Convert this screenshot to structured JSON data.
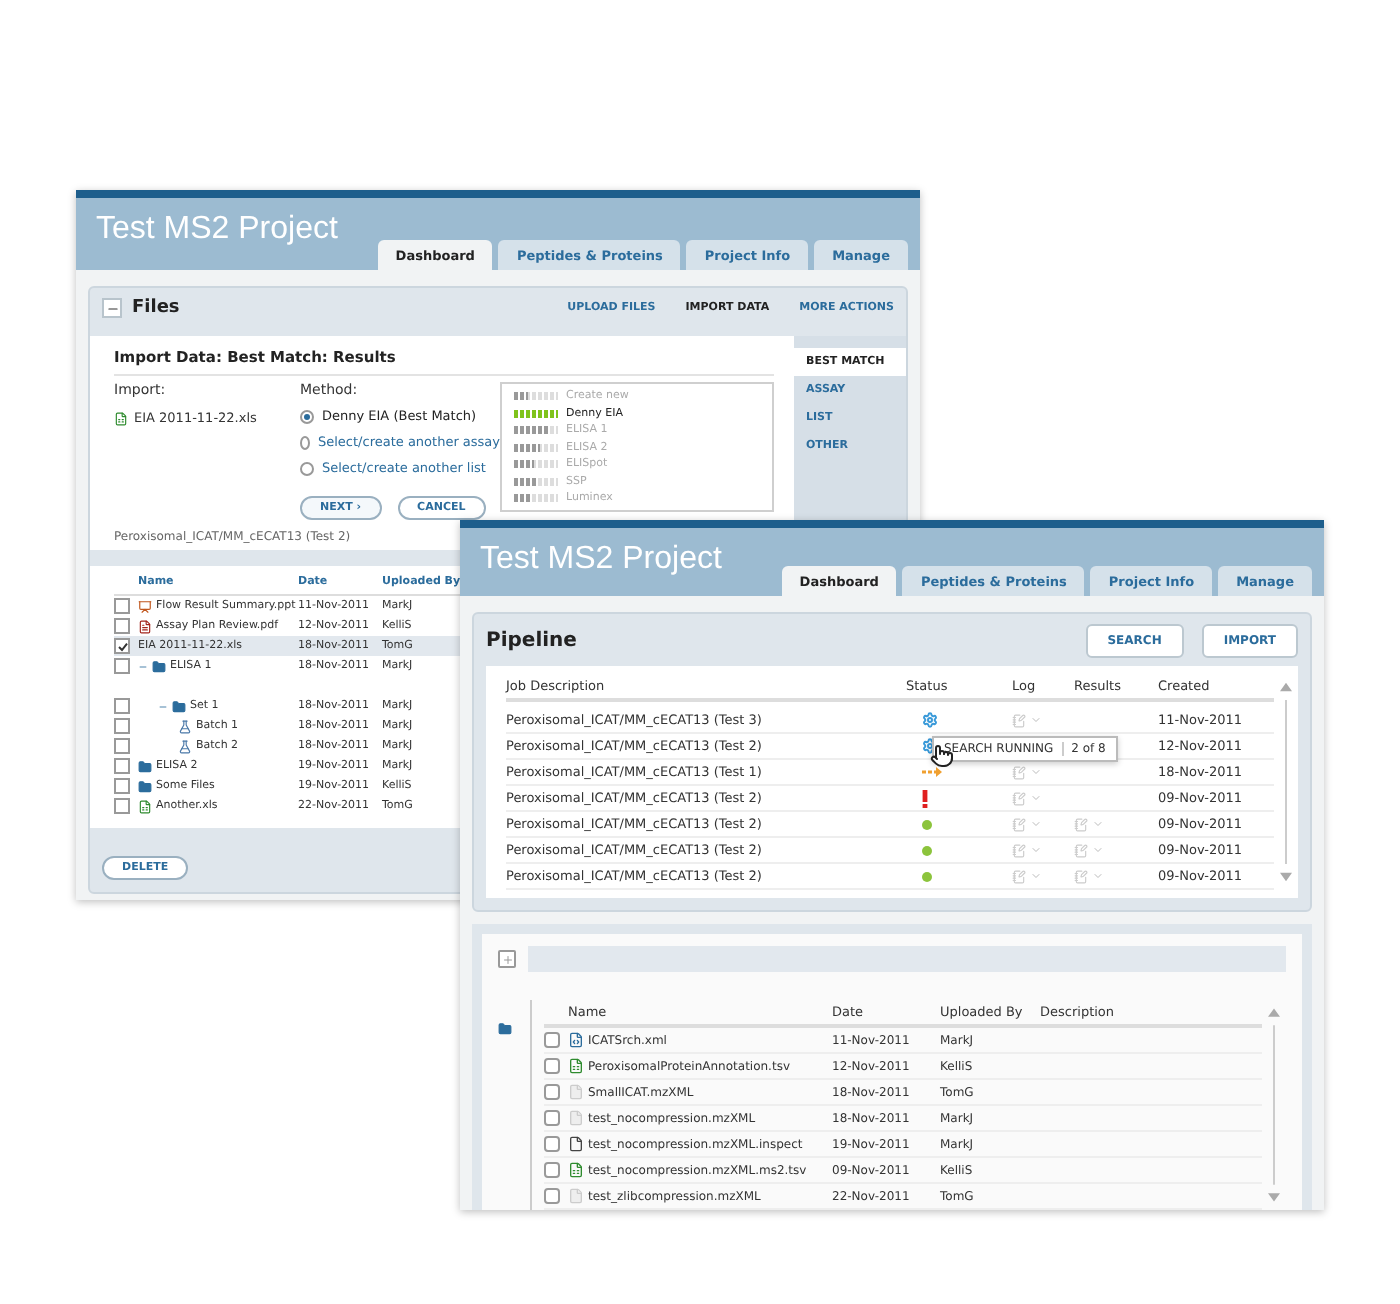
{
  "back_window": {
    "title": "Test MS2 Project",
    "tabs": [
      {
        "label": "Dashboard",
        "selected": true
      },
      {
        "label": "Peptides & Proteins",
        "selected": false
      },
      {
        "label": "Project Info",
        "selected": false
      },
      {
        "label": "Manage",
        "selected": false
      }
    ],
    "files_panel": {
      "title": "Files",
      "expanded": true,
      "actions": [
        {
          "label": "UPLOAD FILES",
          "selected": false
        },
        {
          "label": "IMPORT DATA",
          "selected": true
        },
        {
          "label": "MORE ACTIONS",
          "selected": false
        }
      ],
      "import_dialog": {
        "title": "Import Data: Best Match: Results",
        "import_label": "Import:",
        "file": "EIA 2011-11-22.xls",
        "method_label": "Method:",
        "methods": [
          {
            "label": "Denny EIA (Best Match)",
            "selected": true
          },
          {
            "label": "Select/create another assay",
            "selected": false
          },
          {
            "label": "Select/create another list",
            "selected": false
          }
        ],
        "buttons": [
          {
            "label": "NEXT ›",
            "kind": "primary"
          },
          {
            "label": "CANCEL",
            "kind": "secondary"
          }
        ],
        "matches": [
          {
            "label": "Create new",
            "level": 0.3,
            "selected": false
          },
          {
            "label": "Denny EIA",
            "level": 1,
            "selected": true
          },
          {
            "label": "ELISA 1",
            "level": 0.75,
            "selected": false
          },
          {
            "label": "ELISA 2",
            "level": 0.6,
            "selected": false
          },
          {
            "label": "ELISpot",
            "level": 0.45,
            "selected": false
          },
          {
            "label": "SSP",
            "level": 0.55,
            "selected": false
          },
          {
            "label": "Luminex",
            "level": 0.35,
            "selected": false
          }
        ],
        "side_tabs": [
          {
            "label": "BEST MATCH",
            "selected": true
          },
          {
            "label": "ASSAY",
            "selected": false
          },
          {
            "label": "LIST",
            "selected": false
          },
          {
            "label": "OTHER",
            "selected": false
          }
        ]
      },
      "job_caption": "Peroxisomal_ICAT/MM_cECAT13 (Test 2)",
      "table": {
        "columns": [
          "Name",
          "Date",
          "Uploaded By"
        ],
        "rows": [
          {
            "name": "Flow Result Summary.ppt",
            "kind": "presentation",
            "date": "11-Nov-2011",
            "uploader": "MarkJ",
            "checked": false
          },
          {
            "name": "Assay Plan Review.pdf",
            "kind": "pdf",
            "date": "12-Nov-2011",
            "uploader": "KelliS",
            "checked": false
          },
          {
            "name": "EIA 2011-11-22.xls",
            "date": "18-Nov-2011",
            "uploader": "TomG",
            "checked": true
          },
          {
            "name": "ELISA 1",
            "kind": "folder",
            "expanded": true,
            "date": "18-Nov-2011",
            "uploader": "MarkJ",
            "checked": false,
            "children": [
              {
                "name": "Set 1",
                "kind": "folder",
                "expanded": true,
                "date": "18-Nov-2011",
                "uploader": "MarkJ",
                "checked": false,
                "children": [
                  {
                    "name": "Batch 1",
                    "kind": "batch",
                    "date": "18-Nov-2011",
                    "uploader": "MarkJ",
                    "checked": false
                  },
                  {
                    "name": "Batch 2",
                    "kind": "batch",
                    "date": "18-Nov-2011",
                    "uploader": "MarkJ",
                    "checked": false
                  }
                ]
              }
            ]
          },
          {
            "name": "ELISA 2",
            "kind": "folder",
            "expanded": false,
            "date": "19-Nov-2011",
            "uploader": "MarkJ",
            "checked": false
          },
          {
            "name": "Some Files",
            "kind": "folder",
            "expanded": false,
            "date": "19-Nov-2011",
            "uploader": "KelliS",
            "checked": false
          },
          {
            "name": "Another.xls",
            "kind": "spreadsheet",
            "date": "22-Nov-2011",
            "uploader": "TomG",
            "checked": false
          }
        ]
      },
      "delete_button": "DELETE"
    }
  },
  "front_window": {
    "title": "Test MS2 Project",
    "tabs": [
      {
        "label": "Dashboard",
        "selected": true
      },
      {
        "label": "Peptides & Proteins",
        "selected": false
      },
      {
        "label": "Project Info",
        "selected": false
      },
      {
        "label": "Manage",
        "selected": false
      }
    ],
    "pipeline": {
      "title": "Pipeline",
      "buttons": [
        "SEARCH",
        "IMPORT"
      ],
      "columns": [
        "Job Description",
        "Status",
        "Log",
        "Results",
        "Created"
      ],
      "rows": [
        {
          "job": "Peroxisomal_ICAT/MM_cECAT13 (Test 3)",
          "kind": "running",
          "results": false,
          "created": "11-Nov-2011"
        },
        {
          "job": "Peroxisomal_ICAT/MM_cECAT13 (Test 2)",
          "kind": "running",
          "created": "12-Nov-2011",
          "tooltip": {
            "label": "SEARCH RUNNING",
            "progress": "2 of 8"
          }
        },
        {
          "job": "Peroxisomal_ICAT/MM_cECAT13 (Test 1)",
          "kind": "queued",
          "results": false,
          "created": "18-Nov-2011"
        },
        {
          "job": "Peroxisomal_ICAT/MM_cECAT13 (Test 2)",
          "kind": "error",
          "results": false,
          "created": "09-Nov-2011"
        },
        {
          "job": "Peroxisomal_ICAT/MM_cECAT13 (Test 2)",
          "kind": "complete",
          "results": true,
          "created": "09-Nov-2011"
        },
        {
          "job": "Peroxisomal_ICAT/MM_cECAT13 (Test 2)",
          "kind": "complete",
          "results": true,
          "created": "09-Nov-2011"
        },
        {
          "job": "Peroxisomal_ICAT/MM_cECAT13 (Test 2)",
          "kind": "complete",
          "results": true,
          "created": "09-Nov-2011"
        }
      ]
    },
    "files": {
      "columns": [
        "Name",
        "Date",
        "Uploaded By",
        "Description"
      ],
      "rows": [
        {
          "name": "ICATSrch.xml",
          "kind": "xml",
          "date": "11-Nov-2011",
          "uploader": "MarkJ",
          "checked": false
        },
        {
          "name": "PeroxisomalProteinAnnotation.tsv",
          "kind": "spreadsheet",
          "date": "12-Nov-2011",
          "uploader": "KelliS",
          "checked": false
        },
        {
          "name": "SmallICAT.mzXML",
          "kind": "generic",
          "date": "18-Nov-2011",
          "uploader": "TomG",
          "checked": false
        },
        {
          "name": "test_nocompression.mzXML",
          "kind": "generic",
          "date": "18-Nov-2011",
          "uploader": "MarkJ",
          "checked": false
        },
        {
          "name": "test_nocompression.mzXML.inspect",
          "kind": "text",
          "date": "19-Nov-2011",
          "uploader": "MarkJ",
          "checked": false
        },
        {
          "name": "test_nocompression.mzXML.ms2.tsv",
          "kind": "spreadsheet",
          "date": "09-Nov-2011",
          "uploader": "KelliS",
          "checked": false
        },
        {
          "name": "test_zlibcompression.mzXML",
          "kind": "generic",
          "date": "22-Nov-2011",
          "uploader": "TomG",
          "checked": false
        }
      ]
    }
  }
}
